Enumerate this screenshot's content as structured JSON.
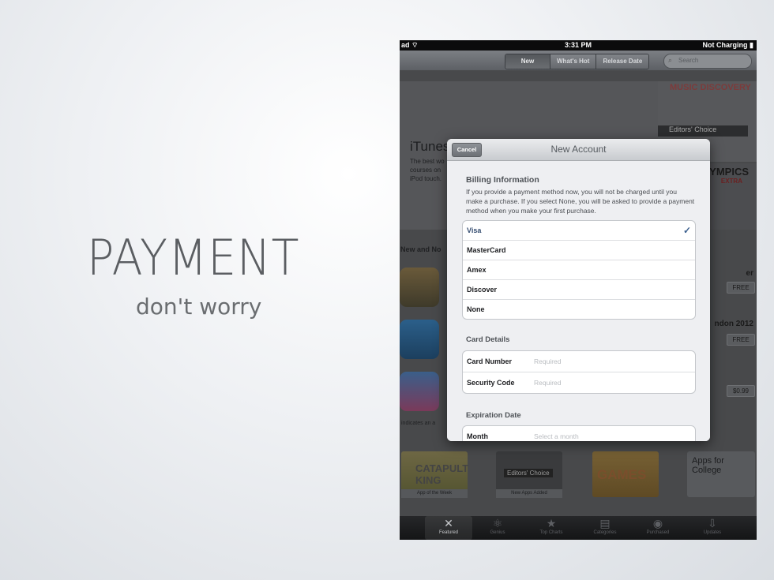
{
  "slide": {
    "title": "PAYMENT",
    "subtitle": "don't worry"
  },
  "status_bar": {
    "carrier": "ad",
    "time": "3:31 PM",
    "battery": "Not Charging"
  },
  "nav": {
    "segments": [
      "New",
      "What's Hot",
      "Release Date"
    ],
    "active_segment": "New",
    "search_placeholder": "Search"
  },
  "store": {
    "banner_title": "iTunes",
    "banner_lines": [
      "The best wo",
      "courses on",
      "iPod touch."
    ],
    "promo1_label": "MUSIC DISCOVERY",
    "promo1_badge": "Editors' Choice",
    "promo2_label": "OLYMPICS",
    "promo2_sub": "EXTRA",
    "section_title": "New and No",
    "right_titles": [
      "er",
      "ndon 2012"
    ],
    "prices": [
      "FREE",
      "FREE",
      "$0.99"
    ],
    "indicator_note": "indicates an a",
    "tiles": [
      {
        "big": "CATAPULT KING",
        "caption": "App of the Week"
      },
      {
        "big": "Editors' Choice",
        "caption": "New Apps Added"
      },
      {
        "big": "GAMES",
        "caption": ""
      },
      {
        "big": "Apps for College",
        "caption": ""
      }
    ]
  },
  "tabbar": {
    "tabs": [
      {
        "label": "Featured",
        "icon": "featured-icon"
      },
      {
        "label": "Genius",
        "icon": "genius-icon"
      },
      {
        "label": "Top Charts",
        "icon": "star-icon"
      },
      {
        "label": "Categories",
        "icon": "categories-icon"
      },
      {
        "label": "Purchased",
        "icon": "purchased-icon"
      },
      {
        "label": "Updates",
        "icon": "updates-icon"
      }
    ],
    "active": "Featured"
  },
  "modal": {
    "title": "New Account",
    "cancel": "Cancel",
    "billing": {
      "heading": "Billing Information",
      "description": "If you provide a payment method now, you will not be charged until you make a purchase. If you select None, you will be asked to provide a payment method when you make your first purchase.",
      "options": [
        "Visa",
        "MasterCard",
        "Amex",
        "Discover",
        "None"
      ],
      "selected": "Visa"
    },
    "card": {
      "heading": "Card Details",
      "number_label": "Card Number",
      "number_placeholder": "Required",
      "security_label": "Security Code",
      "security_placeholder": "Required"
    },
    "expiration": {
      "heading": "Expiration Date",
      "month_label": "Month",
      "month_placeholder": "Select a month"
    }
  },
  "colors": {
    "accent_check": "#3b5f8e",
    "modal_bg": "#eeeff2"
  }
}
